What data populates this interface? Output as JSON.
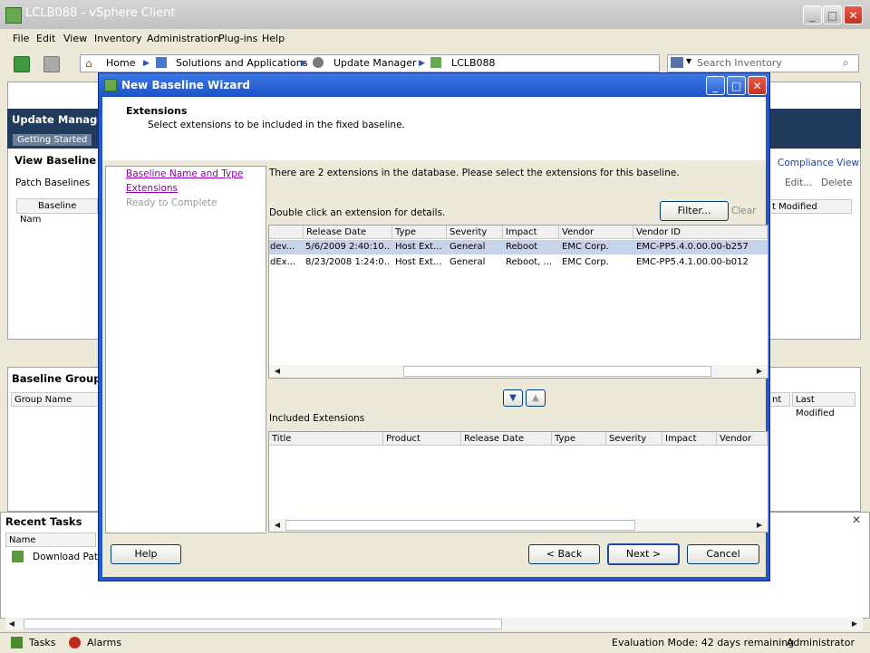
{
  "app": {
    "title": "LCLB088 - vSphere Client",
    "menu": [
      "File",
      "Edit",
      "View",
      "Inventory",
      "Administration",
      "Plug-ins",
      "Help"
    ],
    "breadcrumbs": [
      "Home",
      "Solutions and Applications",
      "Update Manager",
      "LCLB088"
    ],
    "search_placeholder": "Search Inventory"
  },
  "background": {
    "update_manager_title": "Update Manager",
    "getting_started_tab": "Getting Started",
    "view_baseline_label": "View Baseline fo",
    "patch_baselines_tab": "Patch Baselines",
    "baseline_name_col": "Baseline Nam",
    "compliance_view_link": "Compliance View",
    "edit_action": "Edit...",
    "delete_action": "Delete",
    "last_modified_col": "t Modified",
    "baseline_groups_title": "Baseline Groups",
    "group_name_col": "Group Name",
    "last_modified_col2": "Last Modified",
    "nt_col": "nt",
    "recent_tasks_title": "Recent Tasks",
    "name_col": "Name",
    "task_item": "Download Patc"
  },
  "dialog": {
    "title": "New Baseline Wizard",
    "section_title": "Extensions",
    "section_desc": "Select extensions to be included in the fixed baseline.",
    "steps": [
      {
        "label": "Baseline Name and Type",
        "state": "visited"
      },
      {
        "label": "Extensions",
        "state": "current"
      },
      {
        "label": "Ready to Complete",
        "state": "pending"
      }
    ],
    "info_text": "There are 2 extensions in the database. Please select the extensions for this baseline.",
    "double_click_hint": "Double click an extension for details.",
    "filter_button": "Filter...",
    "clear_link": "Clear",
    "ext_columns": [
      "",
      "Release Date",
      "Type",
      "Severity",
      "Impact",
      "Vendor",
      "Vendor ID"
    ],
    "extensions": [
      {
        "name": "dev...",
        "release_date": "5/6/2009 2:40:10...",
        "type": "Host Ext...",
        "severity": "General",
        "impact": "Reboot",
        "vendor": "EMC Corp.",
        "vendor_id": "EMC-PP5.4.0.00.00-b257",
        "selected": true
      },
      {
        "name": "dEx...",
        "release_date": "8/23/2008 1:24:0...",
        "type": "Host Ext...",
        "severity": "General",
        "impact": "Reboot, ...",
        "vendor": "EMC Corp.",
        "vendor_id": "EMC-PP5.4.1.00.00-b012",
        "selected": false
      }
    ],
    "included_label": "Included Extensions",
    "included_columns": [
      "Title",
      "Product",
      "Release Date",
      "Type",
      "Severity",
      "Impact",
      "Vendor"
    ],
    "help_button": "Help",
    "back_button": "< Back",
    "next_button": "Next >",
    "cancel_button": "Cancel"
  },
  "statusbar": {
    "tasks_label": "Tasks",
    "alarms_label": "Alarms",
    "evaluation_text": "Evaluation Mode: 42 days remaining",
    "user": "Administrator"
  },
  "colors": {
    "dialog_title": "#1d52c4",
    "visited_link": "#8b00a8",
    "selected_row": "#c7d3e8",
    "dark_header": "#1f3a5a"
  }
}
